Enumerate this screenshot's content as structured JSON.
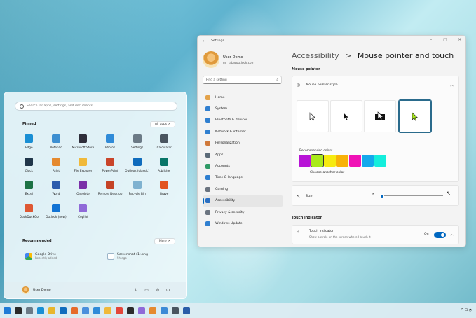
{
  "start_menu": {
    "search_placeholder": "Search for apps, settings, and documents",
    "pinned_title": "Pinned",
    "all_apps_label": "All apps  >",
    "pinned_apps": [
      {
        "label": "Edge",
        "icon": "edge-icon",
        "color": "#1a8fd4"
      },
      {
        "label": "Notepad",
        "icon": "notepad-icon",
        "color": "#3d8fd1"
      },
      {
        "label": "Microsoft Store",
        "icon": "store-icon",
        "color": "#2e2e3a"
      },
      {
        "label": "Photos",
        "icon": "photos-icon",
        "color": "#2f8bd8"
      },
      {
        "label": "Settings",
        "icon": "gear-icon",
        "color": "#6b7a86"
      },
      {
        "label": "Calculator",
        "icon": "calculator-icon",
        "color": "#4a5560"
      },
      {
        "label": "Clock",
        "icon": "clock-icon",
        "color": "#20364a"
      },
      {
        "label": "Paint",
        "icon": "paint-icon",
        "color": "#e58a2f"
      },
      {
        "label": "File Explorer",
        "icon": "folder-icon",
        "color": "#f0b93a"
      },
      {
        "label": "PowerPoint",
        "icon": "powerpoint-icon",
        "color": "#c9452a"
      },
      {
        "label": "Outlook (classic)",
        "icon": "outlook-icon",
        "color": "#0f6cbd"
      },
      {
        "label": "Publisher",
        "icon": "publisher-icon",
        "color": "#077568"
      },
      {
        "label": "Excel",
        "icon": "excel-icon",
        "color": "#1d7245"
      },
      {
        "label": "Word",
        "icon": "word-icon",
        "color": "#2b5cad"
      },
      {
        "label": "OneNote",
        "icon": "onenote-icon",
        "color": "#7b2fa8"
      },
      {
        "label": "Remote Desktop",
        "icon": "remote-desktop-icon",
        "color": "#c54326"
      },
      {
        "label": "Recycle Bin",
        "icon": "recycle-bin-icon",
        "color": "#7fb2d0"
      },
      {
        "label": "Brave",
        "icon": "brave-icon",
        "color": "#e2541f"
      },
      {
        "label": "DuckDuckGo",
        "icon": "duckduckgo-icon",
        "color": "#de5833"
      },
      {
        "label": "Outlook (new)",
        "icon": "outlook-new-icon",
        "color": "#1173d4"
      },
      {
        "label": "Copilot",
        "icon": "copilot-icon",
        "color": "#8f6ad8"
      }
    ],
    "recommended_title": "Recommended",
    "more_label": "More  >",
    "recommended": [
      {
        "title": "Google Drive",
        "subtitle": "Recently added",
        "icon": "google-drive-icon",
        "color": "#34a853"
      },
      {
        "title": "Screenshot (1).png",
        "subtitle": "5h ago",
        "icon": "image-file-icon",
        "color": "#5a7fa0"
      }
    ],
    "user_name": "User Demo"
  },
  "settings": {
    "window_title": "Settings",
    "user_name": "User Demo",
    "user_email": "m__lab@outlook.com",
    "search_placeholder": "Find a setting",
    "nav": [
      {
        "label": "Home",
        "icon": "home-icon",
        "color": "#e3a24a"
      },
      {
        "label": "System",
        "icon": "system-icon",
        "color": "#2f7fd0"
      },
      {
        "label": "Bluetooth & devices",
        "icon": "bluetooth-icon",
        "color": "#2f7fd0"
      },
      {
        "label": "Network & internet",
        "icon": "network-icon",
        "color": "#2f7fd0"
      },
      {
        "label": "Personalization",
        "icon": "brush-icon",
        "color": "#d0793a"
      },
      {
        "label": "Apps",
        "icon": "apps-icon",
        "color": "#5b6a78"
      },
      {
        "label": "Accounts",
        "icon": "accounts-icon",
        "color": "#2f9a66"
      },
      {
        "label": "Time & language",
        "icon": "time-language-icon",
        "color": "#2f7fd0"
      },
      {
        "label": "Gaming",
        "icon": "gaming-icon",
        "color": "#6b7480"
      },
      {
        "label": "Accessibility",
        "icon": "accessibility-icon",
        "color": "#2b6fc2"
      },
      {
        "label": "Privacy & security",
        "icon": "shield-icon",
        "color": "#6b7480"
      },
      {
        "label": "Windows Update",
        "icon": "windows-update-icon",
        "color": "#2f7fd0"
      }
    ],
    "breadcrumb_parent": "Accessibility",
    "breadcrumb_sep": ">",
    "page_title": "Mouse pointer and touch",
    "mouse_pointer_section": "Mouse pointer",
    "mouse_pointer_style_label": "Mouse pointer style",
    "recommended_colors_label": "Recommended colors",
    "colors": [
      "#b713d6",
      "#a9ea1a",
      "#f6ea10",
      "#f8b208",
      "#f012b6",
      "#14a8ec",
      "#14eedc"
    ],
    "selected_color": 1,
    "choose_color_label": "Choose another color",
    "size_label": "Size",
    "size_level_fraction": 0.02,
    "touch_section": "Touch indicator",
    "touch_indicator_label": "Touch indicator",
    "touch_indicator_desc": "Show a circle on the screen where I touch it",
    "touch_toggle_label": "On",
    "accent_color": "#0067c0"
  },
  "taskbar": {
    "icons": [
      {
        "icon": "windows-start-icon",
        "color": "#1e7ad6"
      },
      {
        "icon": "search-icon",
        "color": "#2a2a2a"
      },
      {
        "icon": "gear-icon",
        "color": "#6b7a86"
      },
      {
        "icon": "edge-icon",
        "color": "#1a8fd4"
      },
      {
        "icon": "chrome-icon",
        "color": "#e8b62c"
      },
      {
        "icon": "outlook-icon",
        "color": "#0f6cbd"
      },
      {
        "icon": "firefox-icon",
        "color": "#e66b2b"
      },
      {
        "icon": "chrome-icon",
        "color": "#4a8fdc"
      },
      {
        "icon": "photos-icon",
        "color": "#2f8bd8"
      },
      {
        "icon": "folder-icon",
        "color": "#f0b93a"
      },
      {
        "icon": "camera-icon",
        "color": "#e3473b"
      },
      {
        "icon": "terminal-icon",
        "color": "#2b2b2b"
      },
      {
        "icon": "copilot-icon",
        "color": "#8f6ad8"
      },
      {
        "icon": "paint-icon",
        "color": "#e58a2f"
      },
      {
        "icon": "sparkle-icon",
        "color": "#3c8ad6"
      },
      {
        "icon": "calculator-icon",
        "color": "#4a5560"
      },
      {
        "icon": "powershell-icon",
        "color": "#2a5ca8"
      }
    ],
    "tray_text": "^  ⊡  ◔"
  }
}
